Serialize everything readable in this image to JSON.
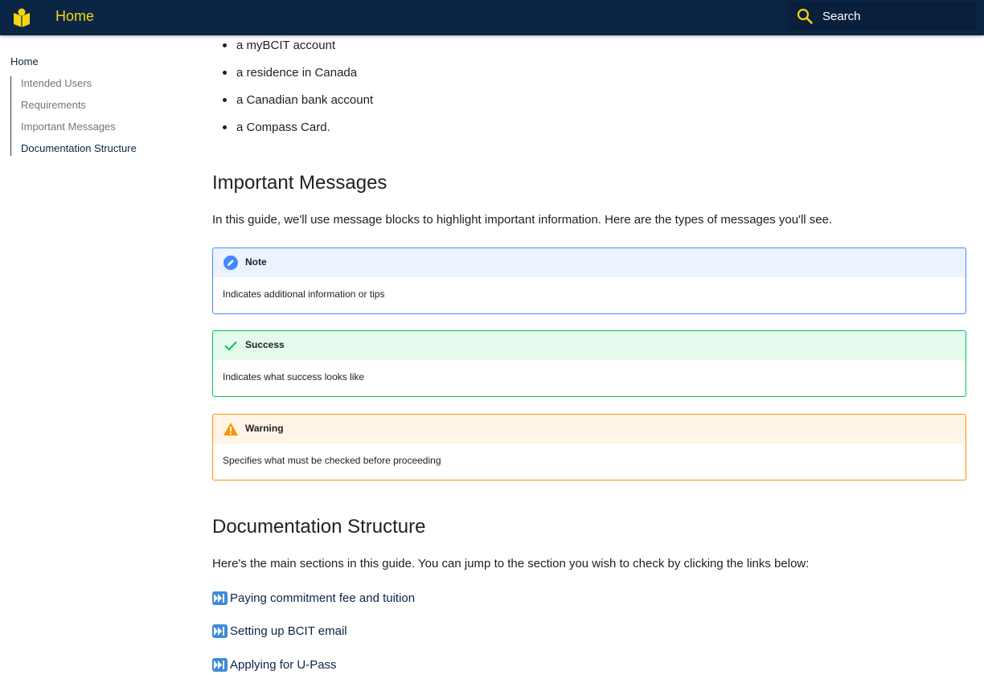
{
  "header": {
    "title": "Home",
    "search_placeholder": "Search",
    "logo_icon": "book-icon",
    "accent": "#f5d60f",
    "bg": "#0b2545"
  },
  "sidebar": {
    "home_label": "Home",
    "items": [
      {
        "label": "Intended Users"
      },
      {
        "label": "Requirements"
      },
      {
        "label": "Important Messages"
      },
      {
        "label": "Documentation Structure"
      }
    ],
    "active_index": 3
  },
  "main": {
    "requirements_bullets": [
      "a myBCIT account",
      "a residence in Canada",
      "a Canadian bank account",
      "a Compass Card."
    ],
    "important_messages": {
      "heading": "Important Messages",
      "intro": "In this guide, we'll use message blocks to highlight important information. Here are the types of messages you'll see.",
      "blocks": [
        {
          "title": "Note",
          "body": "Indicates additional information or tips",
          "icon": "pencil-icon",
          "color": "#448aff"
        },
        {
          "title": "Success",
          "body": "Indicates what success looks like",
          "icon": "check-icon",
          "color": "#00c853"
        },
        {
          "title": "Warning",
          "body": "Specifies what must be checked before proceeding",
          "icon": "warning-icon",
          "color": "#ff9100"
        }
      ]
    },
    "documentation_structure": {
      "heading": "Documentation Structure",
      "intro": "Here's the main sections in this guide. You can jump to the section you wish to check by clicking the links below:",
      "links": [
        {
          "label": "Paying commitment fee and tuition",
          "icon": "fast-forward-icon"
        },
        {
          "label": "Setting up BCIT email",
          "icon": "fast-forward-icon"
        },
        {
          "label": "Applying for U-Pass",
          "icon": "fast-forward-icon"
        }
      ]
    }
  }
}
